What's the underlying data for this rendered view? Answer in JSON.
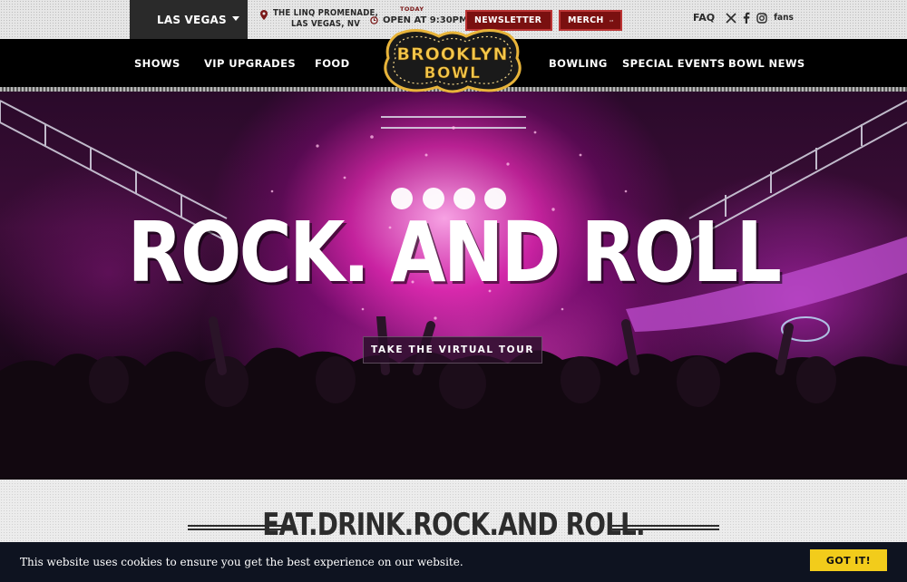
{
  "topbar": {
    "city": "LAS VEGAS",
    "location_line1": "THE LINQ PROMENADE,",
    "location_line2": "LAS VEGAS, NV",
    "today_label": "TODAY",
    "open_text": "OPEN AT 9:30PM",
    "newsletter_label": "NEWSLETTER",
    "merch_label": "MERCH",
    "faq_label": "FAQ",
    "fans_label": "fans",
    "social_icons": [
      "x-icon",
      "facebook-icon",
      "instagram-icon"
    ]
  },
  "nav": {
    "items": [
      "SHOWS",
      "VIP UPGRADES",
      "FOOD",
      "BOWLING",
      "SPECIAL EVENTS",
      "BOWL NEWS"
    ],
    "logo_line1": "BROOKLYN",
    "logo_line2": "BOWL"
  },
  "hero": {
    "title": "ROCK. AND ROLL",
    "tour_button": "TAKE THE VIRTUAL TOUR"
  },
  "section": {
    "tagline": "EAT.DRINK.ROCK.AND ROLL."
  },
  "cookie": {
    "text": "This website uses cookies to ensure you get the best experience on our website.",
    "button": "GOT IT!"
  },
  "colors": {
    "accent_red": "#7a1010",
    "cookie_button": "#f2cc1b",
    "nav_bg": "#000000",
    "logo_gold": "#e8b43a"
  }
}
